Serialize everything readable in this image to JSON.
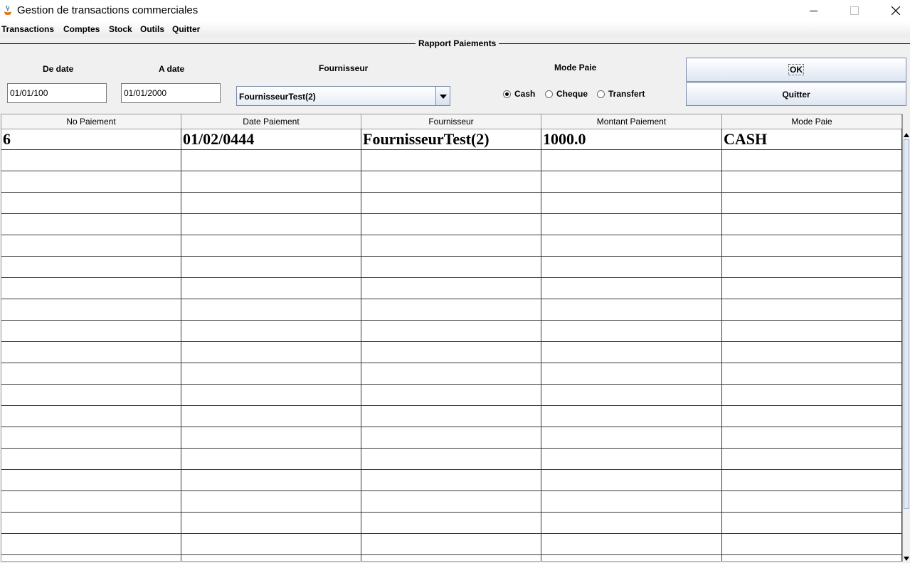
{
  "window": {
    "title": "Gestion de transactions commerciales",
    "minimize_icon": "minimize-icon",
    "maximize_icon": "maximize-icon",
    "close_icon": "close-icon"
  },
  "menu": [
    "Transactions",
    "Comptes",
    "Stock",
    "Outils",
    "Quitter"
  ],
  "panel": {
    "title": "Rapport Paiements"
  },
  "filters": {
    "from_date_label": "De date",
    "from_date_value": "01/01/100",
    "to_date_label": "A date",
    "to_date_value": "01/01/2000",
    "supplier_label": "Fournisseur",
    "supplier_value": "FournisseurTest(2)",
    "payment_mode_label": "Mode Paie",
    "payment_modes": [
      {
        "label": "Cash",
        "selected": true
      },
      {
        "label": "Cheque",
        "selected": false
      },
      {
        "label": "Transfert",
        "selected": false
      }
    ]
  },
  "buttons": {
    "ok": "OK",
    "quit": "Quitter"
  },
  "table": {
    "columns": [
      "No Paiement",
      "Date Paiement",
      "Fournisseur",
      "Montant Paiement",
      "Mode Paie"
    ],
    "rows": [
      [
        "6",
        "01/02/0444",
        "FournisseurTest(2)",
        "1000.0",
        "CASH"
      ]
    ]
  }
}
